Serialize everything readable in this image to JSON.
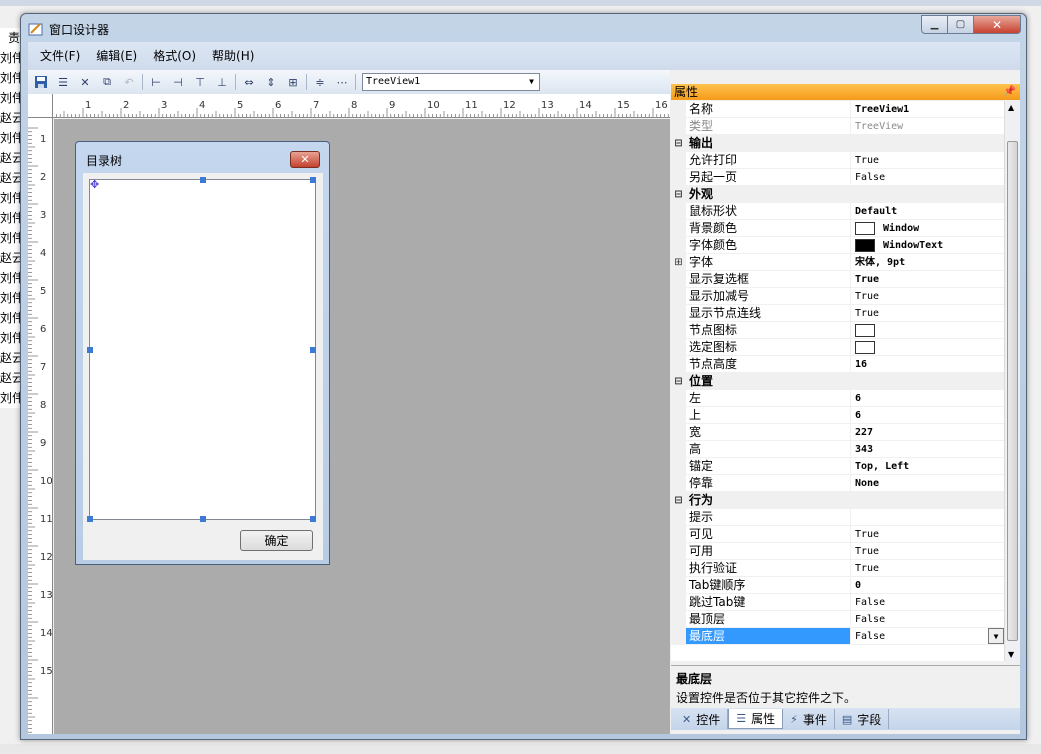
{
  "window": {
    "title": "窗口设计器"
  },
  "menu": [
    "文件(F)",
    "编辑(E)",
    "格式(O)",
    "帮助(H)"
  ],
  "toolbar": {
    "control_combo": "TreeView1",
    "icons": [
      "save-icon",
      "save-all-icon",
      "cut-icon",
      "copy-icon",
      "undo-icon",
      "align-left-icon",
      "align-right-icon",
      "align-top-icon",
      "align-bottom-icon",
      "same-width-icon",
      "same-height-icon",
      "same-size-icon",
      "vertical-spacing-icon",
      "horizontal-spacing-icon"
    ]
  },
  "hruler": [
    "1",
    "2",
    "3",
    "4",
    "5",
    "6",
    "7",
    "8",
    "9",
    "10",
    "11",
    "12",
    "13",
    "14",
    "15",
    "16"
  ],
  "vruler": [
    "1",
    "2",
    "3",
    "4",
    "5",
    "6",
    "7",
    "8",
    "9",
    "10",
    "11",
    "12",
    "13",
    "14",
    "15"
  ],
  "background_list": [
    "刘伟",
    "刘伟",
    "刘伟",
    "赵云",
    "刘伟",
    "赵云",
    "赵云",
    "刘伟",
    "刘伟",
    "刘伟",
    "赵云",
    "刘伟",
    "刘伟",
    "刘伟",
    "刘伟",
    "赵云",
    "赵云",
    "刘伟"
  ],
  "background_top": "责",
  "design_form": {
    "title": "目录树",
    "ok_button": "确定"
  },
  "properties": {
    "header": "属性",
    "rows": [
      {
        "kind": "prop",
        "name": "名称",
        "value": "TreeView1",
        "bold": true
      },
      {
        "kind": "prop",
        "name": "类型",
        "value": "TreeView",
        "grey": true
      },
      {
        "kind": "cat",
        "name": "输出"
      },
      {
        "kind": "prop",
        "name": "允许打印",
        "value": "True"
      },
      {
        "kind": "prop",
        "name": "另起一页",
        "value": "False"
      },
      {
        "kind": "cat",
        "name": "外观"
      },
      {
        "kind": "prop",
        "name": "鼠标形状",
        "value": "Default",
        "bold": true
      },
      {
        "kind": "prop",
        "name": "背景颜色",
        "value": "Window",
        "bold": true,
        "swatch": "#ffffff"
      },
      {
        "kind": "prop",
        "name": "字体颜色",
        "value": "WindowText",
        "bold": true,
        "swatch": "#000000"
      },
      {
        "kind": "prop",
        "name": "字体",
        "value": "宋体, 9pt",
        "bold": true,
        "expand": true
      },
      {
        "kind": "prop",
        "name": "显示复选框",
        "value": "True",
        "bold": true
      },
      {
        "kind": "prop",
        "name": "显示加减号",
        "value": "True"
      },
      {
        "kind": "prop",
        "name": "显示节点连线",
        "value": "True"
      },
      {
        "kind": "prop",
        "name": "节点图标",
        "value": "",
        "swatch": "#ffffff"
      },
      {
        "kind": "prop",
        "name": "选定图标",
        "value": "",
        "swatch": "#ffffff"
      },
      {
        "kind": "prop",
        "name": "节点高度",
        "value": "16",
        "bold": true
      },
      {
        "kind": "cat",
        "name": "位置"
      },
      {
        "kind": "prop",
        "name": "左",
        "value": "6",
        "bold": true
      },
      {
        "kind": "prop",
        "name": "上",
        "value": "6",
        "bold": true
      },
      {
        "kind": "prop",
        "name": "宽",
        "value": "227",
        "bold": true
      },
      {
        "kind": "prop",
        "name": "高",
        "value": "343",
        "bold": true
      },
      {
        "kind": "prop",
        "name": "锚定",
        "value": "Top, Left",
        "bold": true
      },
      {
        "kind": "prop",
        "name": "停靠",
        "value": "None",
        "bold": true
      },
      {
        "kind": "cat",
        "name": "行为"
      },
      {
        "kind": "prop",
        "name": "提示",
        "value": ""
      },
      {
        "kind": "prop",
        "name": "可见",
        "value": "True"
      },
      {
        "kind": "prop",
        "name": "可用",
        "value": "True"
      },
      {
        "kind": "prop",
        "name": "执行验证",
        "value": "True"
      },
      {
        "kind": "prop",
        "name": "Tab键顺序",
        "value": "0",
        "bold": true
      },
      {
        "kind": "prop",
        "name": "跳过Tab键",
        "value": "False"
      },
      {
        "kind": "prop",
        "name": "最顶层",
        "value": "False"
      },
      {
        "kind": "prop",
        "name": "最底层",
        "value": "False",
        "selected": true
      }
    ],
    "desc_title": "最底层",
    "desc_text": "设置控件是否位于其它控件之下。"
  },
  "tabs": [
    {
      "label": "控件",
      "icon": "tools-icon",
      "glyph": "✕"
    },
    {
      "label": "属性",
      "icon": "properties-icon",
      "glyph": "☰",
      "active": true
    },
    {
      "label": "事件",
      "icon": "lightning-icon",
      "glyph": "⚡"
    },
    {
      "label": "字段",
      "icon": "fields-icon",
      "glyph": "▤"
    }
  ]
}
